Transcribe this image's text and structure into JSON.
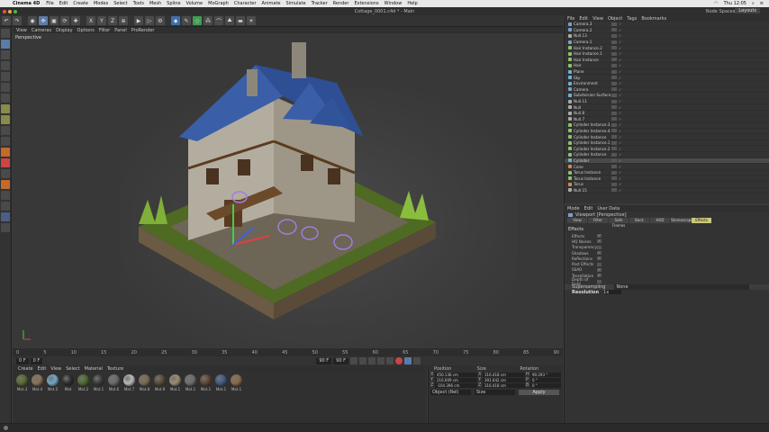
{
  "menubar": {
    "app": "Cinema 4D",
    "items": [
      "File",
      "Edit",
      "Create",
      "Modes",
      "Select",
      "Tools",
      "Mesh",
      "Spline",
      "Volume",
      "MoGraph",
      "Character",
      "Animate",
      "Simulate",
      "Tracker",
      "Render",
      "Extensions",
      "Window",
      "Help"
    ],
    "clock": "Thu 12:05"
  },
  "window": {
    "title": "Cottage_0001.c4d * - Main",
    "node_spaces": "Node Spaces:",
    "layouts": "Layouts"
  },
  "viewport": {
    "menu": [
      "View",
      "Cameras",
      "Display",
      "Options",
      "Filter",
      "Panel",
      "ProRender"
    ],
    "label": "Perspective",
    "bg_color": "#383838"
  },
  "timeline": {
    "ticks": [
      "0",
      "5",
      "10",
      "15",
      "20",
      "25",
      "30",
      "35",
      "40",
      "45",
      "50",
      "55",
      "60",
      "65",
      "70",
      "75",
      "80",
      "85",
      "90"
    ],
    "start": "0 F",
    "current": "0 F",
    "end": "90 F",
    "max": "90 F"
  },
  "materials": {
    "menu": [
      "Create",
      "Edit",
      "View",
      "Select",
      "Material",
      "Texture"
    ],
    "items": [
      {
        "label": "Mat.3",
        "color": "#5b6a2f"
      },
      {
        "label": "Mat.4",
        "color": "#8a7355"
      },
      {
        "label": "Mat.5",
        "color": "#6fa8c8"
      },
      {
        "label": "Mat",
        "color": "#2d2d2d"
      },
      {
        "label": "Mat.2",
        "color": "#4d6b2a"
      },
      {
        "label": "Mat.1",
        "color": "#3a3a3a"
      },
      {
        "label": "Mat.6",
        "color": "#6a6a6a"
      },
      {
        "label": "Mat.7",
        "color": "#b9b9b9"
      },
      {
        "label": "Mat.8",
        "color": "#7b6a50"
      },
      {
        "label": "Mat.9",
        "color": "#5a4a38"
      },
      {
        "label": "Mat.1",
        "color": "#9a8c70"
      },
      {
        "label": "Mat.1",
        "color": "#6e6e6e"
      },
      {
        "label": "Mat.1",
        "color": "#5e4632"
      },
      {
        "label": "Mat.1",
        "color": "#3f5a86"
      },
      {
        "label": "Mat.1",
        "color": "#8a6a48"
      }
    ]
  },
  "coordinates": {
    "headers": [
      "Position",
      "Size",
      "Rotation"
    ],
    "rows": [
      {
        "axis": "X",
        "pos": "450.136 cm",
        "size": "316.418 cm",
        "rot_axis": "H",
        "rot": "90.293 °"
      },
      {
        "axis": "Y",
        "pos": "216.009 cm",
        "size": "391.642 cm",
        "rot_axis": "P",
        "rot": "0 °"
      },
      {
        "axis": "Z",
        "pos": "-104.396 cm",
        "size": "316.418 cm",
        "rot_axis": "B",
        "rot": "0 °"
      }
    ],
    "mode": "Object (Rel)",
    "size_mode": "Size",
    "apply": "Apply"
  },
  "objects": {
    "menu": [
      "File",
      "Edit",
      "View",
      "Object",
      "Tags",
      "Bookmarks"
    ],
    "items": [
      {
        "name": "Camera.3",
        "color": "#7aa0c8"
      },
      {
        "name": "Camera.2",
        "color": "#7aa0c8"
      },
      {
        "name": "Null.13",
        "color": "#aaaaaa"
      },
      {
        "name": "Camera.1",
        "color": "#7aa0c8"
      },
      {
        "name": "Hair Instance.2",
        "color": "#8fc06a"
      },
      {
        "name": "Hair Instance.1",
        "color": "#8fc06a"
      },
      {
        "name": "Hair Instance",
        "color": "#8fc06a"
      },
      {
        "name": "Hair",
        "color": "#8fc06a"
      },
      {
        "name": "Plane",
        "color": "#6fb0d0"
      },
      {
        "name": "Sky",
        "color": "#6fb0d0"
      },
      {
        "name": "Environment",
        "color": "#6fb0d0"
      },
      {
        "name": "Camera",
        "color": "#7aa0c8"
      },
      {
        "name": "Subdivision Surface",
        "color": "#6fb0d0"
      },
      {
        "name": "Null.11",
        "color": "#aaaaaa"
      },
      {
        "name": "Null",
        "color": "#aaaaaa"
      },
      {
        "name": "Null.8",
        "color": "#aaaaaa"
      },
      {
        "name": "Null.7",
        "color": "#aaaaaa"
      },
      {
        "name": "Cylinder Instance.3",
        "color": "#8fc06a"
      },
      {
        "name": "Cylinder Instance.4",
        "color": "#8fc06a"
      },
      {
        "name": "Cylinder Instance",
        "color": "#8fc06a"
      },
      {
        "name": "Cylinder Instance.1",
        "color": "#8fc06a"
      },
      {
        "name": "Cylinder Instance.2",
        "color": "#8fc06a"
      },
      {
        "name": "Cylinder Instance",
        "color": "#8fc06a"
      },
      {
        "name": "Cylinder",
        "color": "#6fb0d0"
      },
      {
        "name": "Cone",
        "color": "#d08a4a"
      },
      {
        "name": "Torus Instance",
        "color": "#8fc06a"
      },
      {
        "name": "Torus Instance",
        "color": "#8fc06a"
      },
      {
        "name": "Torus",
        "color": "#d08a4a"
      },
      {
        "name": "Null.15",
        "color": "#aaaaaa"
      }
    ]
  },
  "attributes": {
    "menu": [
      "Mode",
      "Edit",
      "User Data"
    ],
    "header": "Viewport [Perspective]",
    "tabs": [
      "View",
      "Filter",
      "Safe Frames",
      "Back",
      "HUD",
      "Stereoscopic",
      "Effects"
    ],
    "active_tab": "Effects",
    "section": "Effects",
    "props": [
      {
        "label": "Effects",
        "checked": "✓"
      },
      {
        "label": "HQ Noises",
        "checked": "✓"
      },
      {
        "label": "Transparency",
        "checked": ""
      },
      {
        "label": "Shadows",
        "checked": "✓"
      },
      {
        "label": "Reflections",
        "checked": "✓"
      },
      {
        "label": "Post Effects",
        "checked": ""
      },
      {
        "label": "SSAO",
        "checked": "✓"
      },
      {
        "label": "Tessellation",
        "checked": "✓"
      },
      {
        "label": "Depth of Field",
        "checked": ""
      }
    ],
    "supersampling_label": "Supersampling",
    "supersampling_value": "None",
    "resolution_label": "Resolution",
    "resolution_value": "1x"
  }
}
